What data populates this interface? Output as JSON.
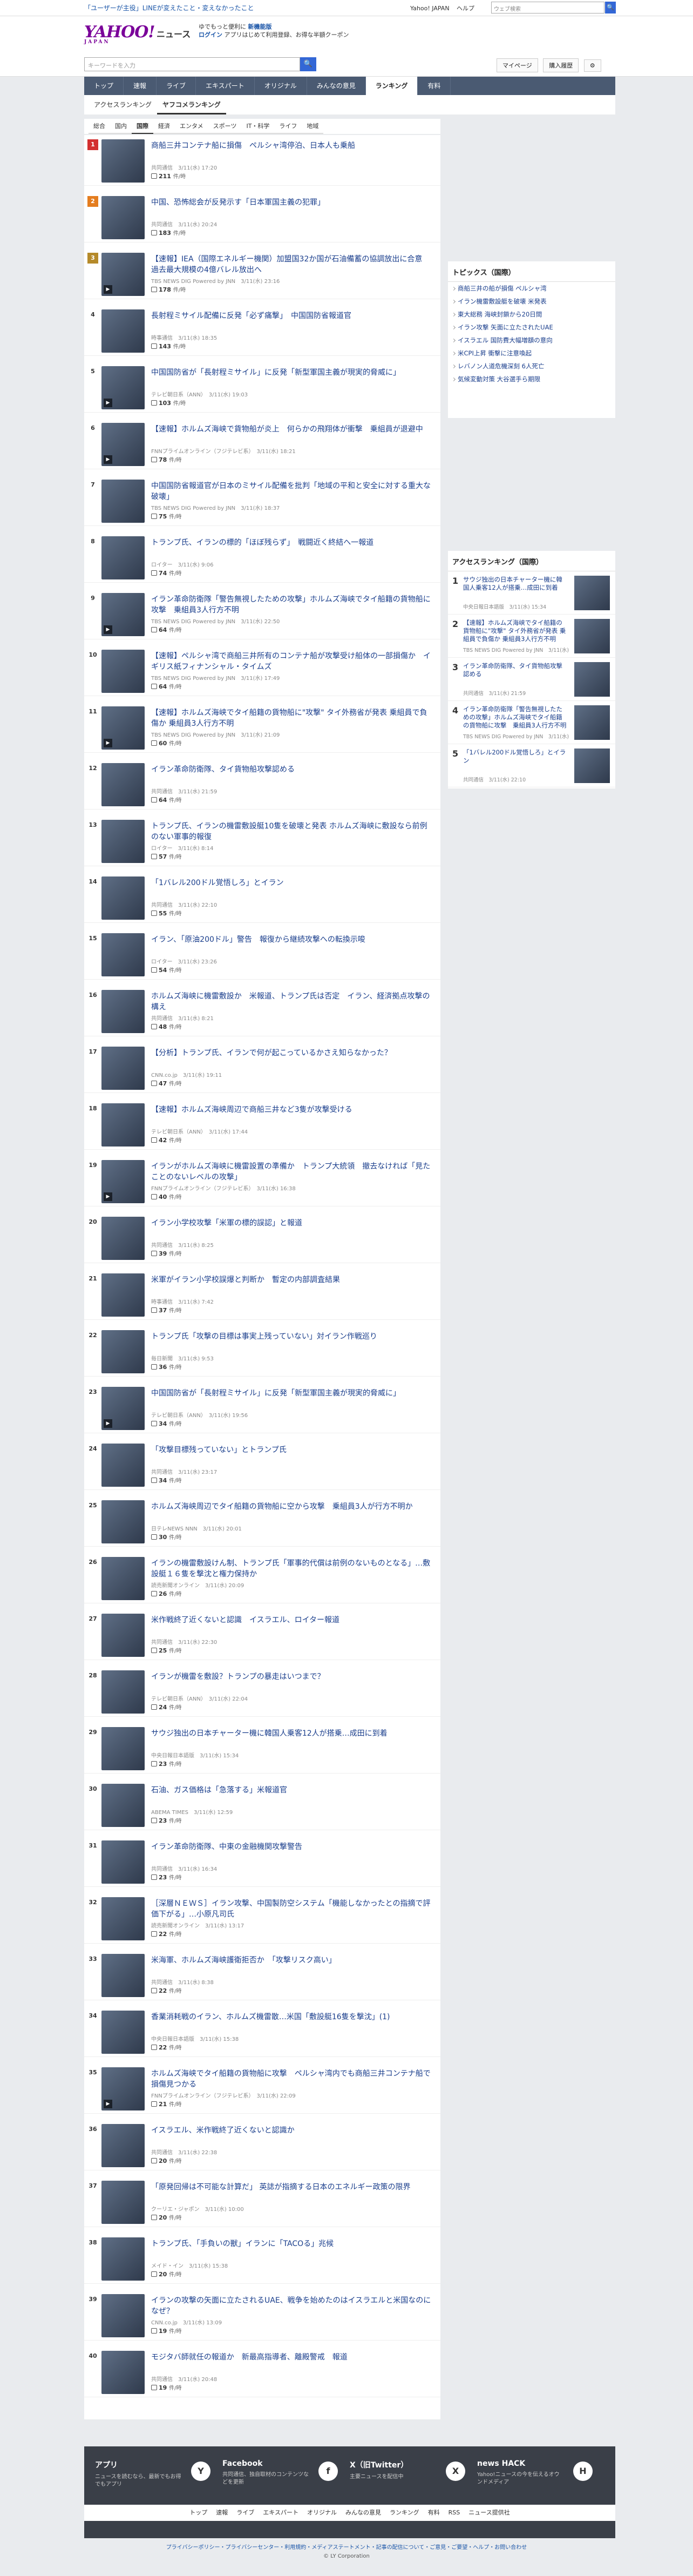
{
  "topbar": {
    "promo": "「ユーザーが主役」LINEが変えたこと・変えなかったこと",
    "links": [
      "Yahoo! JAPAN",
      "ヘルプ"
    ],
    "search_placeholder": "ウェブ検索",
    "search_btn": "🔍"
  },
  "header": {
    "logo": "YAHOO!",
    "logo_sub": "JAPAN",
    "service": "ニュース",
    "promo1": "ゆでもっと便利に",
    "promo1_b": "新機能版",
    "promo2": "ログイン",
    "promo2_t": "アプリはじめて利用登録、お得な半額クーポン"
  },
  "search": {
    "placeholder": "キーワードを入力",
    "btn": "🔍",
    "mypage": "マイページ",
    "premium": "購入履歴",
    "gear": "⚙"
  },
  "gnav": [
    "トップ",
    "速報",
    "ライブ",
    "エキスパート",
    "オリジナル",
    "みんなの意見",
    "ランキング",
    "有料"
  ],
  "rtabs": [
    "アクセスランキング",
    "ヤフコメランキング"
  ],
  "cats": [
    "総合",
    "国内",
    "国際",
    "経済",
    "エンタメ",
    "スポーツ",
    "IT・科学",
    "ライフ",
    "地域"
  ],
  "comment_unit": "件/時",
  "items": [
    {
      "rank": "1",
      "title": "商船三井コンテナ船に損傷　ペルシャ湾停泊、日本人も乗船",
      "meta": "共同通信　3/11(水) 17:20",
      "count": "211",
      "video": false
    },
    {
      "rank": "2",
      "title": "中国、恐怖総会が反発示す「日本軍国主義の犯罪」",
      "meta": "共同通信　3/11(水) 20:24",
      "count": "183",
      "video": false
    },
    {
      "rank": "3",
      "title": "【速報】IEA（国際エネルギー機関）加盟国32か国が石油備蓄の協調放出に合意　過去最大規模の4億バレル放出へ",
      "meta": "TBS NEWS DIG Powered by JNN　3/11(水) 23:16",
      "count": "178",
      "video": true
    },
    {
      "rank": "4",
      "title": "長射程ミサイル配備に反発「必ず痛撃」　中国国防省報道官",
      "meta": "時事通信　3/11(水) 18:35",
      "count": "143",
      "video": false
    },
    {
      "rank": "5",
      "title": "中国国防省が「長射程ミサイル」に反発「新型軍国主義が現実的脅威に」",
      "meta": "テレビ朝日系（ANN）　3/11(水) 19:03",
      "count": "103",
      "video": true
    },
    {
      "rank": "6",
      "title": "【速報】ホルムズ海峡で貨物船が炎上　何らかの飛翔体が衝撃　乗組員が退避中",
      "meta": "FNNプライムオンライン（フジテレビ系）　3/11(水) 18:21",
      "count": "78",
      "video": true
    },
    {
      "rank": "7",
      "title": "中国国防省報道官が日本のミサイル配備を批判「地域の平和と安全に対する重大な破壊」",
      "meta": "TBS NEWS DIG Powered by JNN　3/11(水) 18:37",
      "count": "75",
      "video": false
    },
    {
      "rank": "8",
      "title": "トランプ氏、イランの標的「ほぼ残らず」　戦闘近く終結へ一報道",
      "meta": "ロイター　3/11(水) 9:06",
      "count": "74",
      "video": false
    },
    {
      "rank": "9",
      "title": "イラン革命防衛隊「警告無視したための攻撃」ホルムズ海峡でタイ船籍の貨物船に攻撃　乗組員3人行方不明",
      "meta": "TBS NEWS DIG Powered by JNN　3/11(水) 22:50",
      "count": "64",
      "video": true
    },
    {
      "rank": "10",
      "title": "【速報】ペルシャ湾で商船三井所有のコンテナ船が攻撃受け船体の一部損傷か　イギリス紙フィナンシャル・タイムズ",
      "meta": "TBS NEWS DIG Powered by JNN　3/11(水) 17:49",
      "count": "64",
      "video": false
    },
    {
      "rank": "11",
      "title": "【速報】ホルムズ海峡でタイ船籍の貨物船に\"攻撃\" タイ外務省が発表 乗組員で負傷か 乗組員3人行方不明",
      "meta": "TBS NEWS DIG Powered by JNN　3/11(水) 21:09",
      "count": "60",
      "video": true
    },
    {
      "rank": "12",
      "title": "イラン革命防衛隊、タイ貨物船攻撃認める",
      "meta": "共同通信　3/11(水) 21:59",
      "count": "64",
      "video": false
    },
    {
      "rank": "13",
      "title": "トランプ氏、イランの機雷敷設艇10隻を破壊と発表 ホルムズ海峡に敷設なら前例のない軍事的報復",
      "meta": "ロイター　3/11(水) 8:14",
      "count": "57",
      "video": false
    },
    {
      "rank": "14",
      "title": "「1バレル200ドル覚悟しろ」とイラン",
      "meta": "共同通信　3/11(水) 22:10",
      "count": "55",
      "video": false
    },
    {
      "rank": "15",
      "title": "イラン、「原油200ドル」警告　報復から継続攻撃への転換示唆",
      "meta": "ロイター　3/11(水) 23:26",
      "count": "54",
      "video": false
    },
    {
      "rank": "16",
      "title": "ホルムズ海峡に機雷敷設か　米報道、トランプ氏は否定　イラン、経済拠点攻撃の構え",
      "meta": "共同通信　3/11(水) 8:21",
      "count": "48",
      "video": false
    },
    {
      "rank": "17",
      "title": "【分析】トランプ氏、イランで何が起こっているかさえ知らなかった？",
      "meta": "CNN.co.jp　3/11(水) 19:11",
      "count": "47",
      "video": false
    },
    {
      "rank": "18",
      "title": "【速報】ホルムズ海峡周辺で商船三井など3隻が攻撃受ける",
      "meta": "テレビ朝日系（ANN）　3/11(水) 17:44",
      "count": "42",
      "video": false
    },
    {
      "rank": "19",
      "title": "イランがホルムズ海峡に機雷設置の準備か　トランプ大統領　撤去なければ「見たことのないレベルの攻撃」",
      "meta": "FNNプライムオンライン（フジテレビ系）　3/11(水) 16:38",
      "count": "40",
      "video": true
    },
    {
      "rank": "20",
      "title": "イラン小学校攻撃「米軍の標的誤認」と報道",
      "meta": "共同通信　3/11(水) 8:25",
      "count": "39",
      "video": false
    },
    {
      "rank": "21",
      "title": "米軍がイラン小学校誤爆と判断か　暫定の内部調査結果",
      "meta": "時事通信　3/11(水) 7:42",
      "count": "37",
      "video": false
    },
    {
      "rank": "22",
      "title": "トランプ氏「攻撃の目標は事実上残っていない」対イラン作戦巡り",
      "meta": "毎日新聞　3/11(水) 9:53",
      "count": "36",
      "video": false
    },
    {
      "rank": "23",
      "title": "中国国防省が「長射程ミサイル」に反発「新型軍国主義が現実的脅威に」",
      "meta": "テレビ朝日系（ANN）　3/11(水) 19:56",
      "count": "34",
      "video": true
    },
    {
      "rank": "24",
      "title": "「攻撃目標残っていない」とトランプ氏",
      "meta": "共同通信　3/11(水) 23:17",
      "count": "34",
      "video": false
    },
    {
      "rank": "25",
      "title": "ホルムズ海峡周辺でタイ船籍の貨物船に空から攻撃　乗組員3人が行方不明か",
      "meta": "日テレNEWS NNN　3/11(水) 20:01",
      "count": "30",
      "video": false
    },
    {
      "rank": "26",
      "title": "イランの機雷敷設けん制、トランプ氏「軍事的代償は前例のないものとなる」…敷設艇１６隻を撃沈と権力保持か",
      "meta": "読売新聞オンライン　3/11(水) 20:09",
      "count": "26",
      "video": false
    },
    {
      "rank": "27",
      "title": "米作戦終了近くないと認識　イスラエル、ロイター報道",
      "meta": "共同通信　3/11(水) 22:30",
      "count": "25",
      "video": false
    },
    {
      "rank": "28",
      "title": "イランが機雷を敷設？トランプの暴走はいつまで？",
      "meta": "テレビ朝日系（ANN）　3/11(水) 22:04",
      "count": "24",
      "video": false
    },
    {
      "rank": "29",
      "title": "サウジ独出の日本チャーター機に韓国人乗客12人が搭乗…成田に到着",
      "meta": "中央日報日本語版　3/11(水) 15:34",
      "count": "23",
      "video": false
    },
    {
      "rank": "30",
      "title": "石油、ガス価格は「急落する」米報道官",
      "meta": "ABEMA TIMES　3/11(水) 12:59",
      "count": "23",
      "video": false
    },
    {
      "rank": "31",
      "title": "イラン革命防衛隊、中東の金融機関攻撃警告",
      "meta": "共同通信　3/11(水) 16:34",
      "count": "23",
      "video": false
    },
    {
      "rank": "32",
      "title": "［深層ＮＥＷＳ］イラン攻撃、中国製防空システム「機能しなかったとの指摘で評価下がる」…小原凡司氏",
      "meta": "読売新聞オンライン　3/11(水) 13:17",
      "count": "22",
      "video": false
    },
    {
      "rank": "33",
      "title": "米海軍、ホルムズ海峡護衛拒否か　「攻撃リスク高い」",
      "meta": "共同通信　3/11(水) 8:38",
      "count": "22",
      "video": false
    },
    {
      "rank": "34",
      "title": "香業消耗戦のイラン、ホルムズ機雷散…米国「敷設艇16隻を撃沈」(1)",
      "meta": "中央日報日本語版　3/11(水) 15:38",
      "count": "22",
      "video": false
    },
    {
      "rank": "35",
      "title": "ホルムズ海峡でタイ船籍の貨物船に攻撃　ペルシャ湾内でも商船三井コンテナ船で損傷見つかる",
      "meta": "FNNプライムオンライン（フジテレビ系）　3/11(水) 22:09",
      "count": "21",
      "video": true
    },
    {
      "rank": "36",
      "title": "イスラエル、米作戦終了近くないと認識か",
      "meta": "共同通信　3/11(水) 22:38",
      "count": "20",
      "video": false
    },
    {
      "rank": "37",
      "title": "「原発回帰は不可能な計算だ」 英誌が指摘する日本のエネルギー政策の限界",
      "meta": "クーリエ・ジャポン　3/11(水) 10:00",
      "count": "20",
      "video": false
    },
    {
      "rank": "38",
      "title": "トランプ氏、「手負いの獣」イランに「TACOる」兆候",
      "meta": "メイド・イン　3/11(水) 15:38",
      "count": "20",
      "video": false
    },
    {
      "rank": "39",
      "title": "イランの攻撃の矢面に立たされるUAE、戦争を始めたのはイスラエルと米国なのになぜ？",
      "meta": "CNN.co.jp　3/11(水) 13:09",
      "count": "19",
      "video": false
    },
    {
      "rank": "40",
      "title": "モジタバ師就任の報道か　新最高指導者、離殿警戒　報道",
      "meta": "共同通信　3/11(水) 20:48",
      "count": "19",
      "video": false
    }
  ],
  "side_topics": {
    "title": "トピックス（国際）",
    "items": [
      "商船三井の船が損傷 ペルシャ湾",
      "イラン機雷敷設艇を破壊 米発表",
      "東大総務 海峡封鎖から20日間",
      "イラン攻撃 矢面に立たされたUAE",
      "イスラエル 国防費大幅増額の意向",
      "米CPI上昇 衝撃に注意喚起",
      "レバノン人道危機深刻 6人死亡",
      "気候変動対策 大谷選手ら期限"
    ]
  },
  "side_rank": {
    "title": "アクセスランキング（国際）",
    "items": [
      {
        "n": "1",
        "t": "サウジ独出の日本チャーター機に韓国人乗客12人が搭乗…成田に到着",
        "m": "中央日報日本語版　3/11(水) 15:34"
      },
      {
        "n": "2",
        "t": "【速報】ホルムズ海峡でタイ船籍の貨物船に\"攻撃\" タイ外務省が発表 乗組員で負傷か 乗組員3人行方不明",
        "m": "TBS NEWS DIG Powered by JNN　3/11(水) 21:09"
      },
      {
        "n": "3",
        "t": "イラン革命防衛隊、タイ貨物船攻撃認める",
        "m": "共同通信　3/11(水) 21:59"
      },
      {
        "n": "4",
        "t": "イラン革命防衛隊「警告無視したための攻撃」ホルムズ海峡でタイ船籍の貨物船に攻撃　乗組員3人行方不明",
        "m": "TBS NEWS DIG Powered by JNN　3/11(水) 22:50"
      },
      {
        "n": "5",
        "t": "「1バレル200ドル覚悟しろ」とイラン",
        "m": "共同通信　3/11(水) 22:10"
      }
    ]
  },
  "footer": {
    "apps": [
      {
        "t": "アプリ",
        "p": "ニュースを読むなら、最新でもお得でもアプリ",
        "ic": "Y"
      },
      {
        "t": "Facebook",
        "p": "共同通信、独自取材のコンテンツなどを更新",
        "ic": "f"
      },
      {
        "t": "X（旧Twitter）",
        "p": "主要ニュースを配信中",
        "ic": "X"
      },
      {
        "t": "news HACK",
        "p": "Yahoo!ニュースの今を伝えるオウンドメディア",
        "ic": "H"
      }
    ],
    "nav": [
      "トップ",
      "速報",
      "ライブ",
      "エキスパート",
      "オリジナル",
      "みんなの意見",
      "ランキング",
      "有料",
      "RSS",
      "ニュース提供社"
    ],
    "links": "プライバシーポリシー・プライバシーセンター・利用規約・メディアステートメント・記事の配信について・ご意見・ご要望・ヘルプ・お問い合わせ",
    "copyright": "© LY Corporation"
  }
}
